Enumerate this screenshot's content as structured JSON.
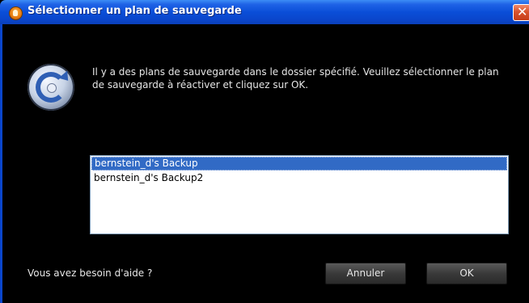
{
  "window": {
    "title": "Sélectionner un plan de sauvegarde",
    "close_glyph": "✕",
    "title_icon": "app-orange-icon",
    "accent_color": "#0a46cc"
  },
  "dialog": {
    "icon": "backup-clock-icon",
    "message": "Il y a des plans de sauvegarde dans le dossier spécifié. Veuillez sélectionner le plan de sauvegarde à réactiver et cliquez sur OK.",
    "plans": [
      {
        "label": "bernstein_d's Backup",
        "selected": true
      },
      {
        "label": "bernstein_d's Backup2",
        "selected": false
      }
    ],
    "help_text": "Vous avez besoin d'aide ?",
    "cancel_label": "Annuler",
    "ok_label": "OK"
  }
}
